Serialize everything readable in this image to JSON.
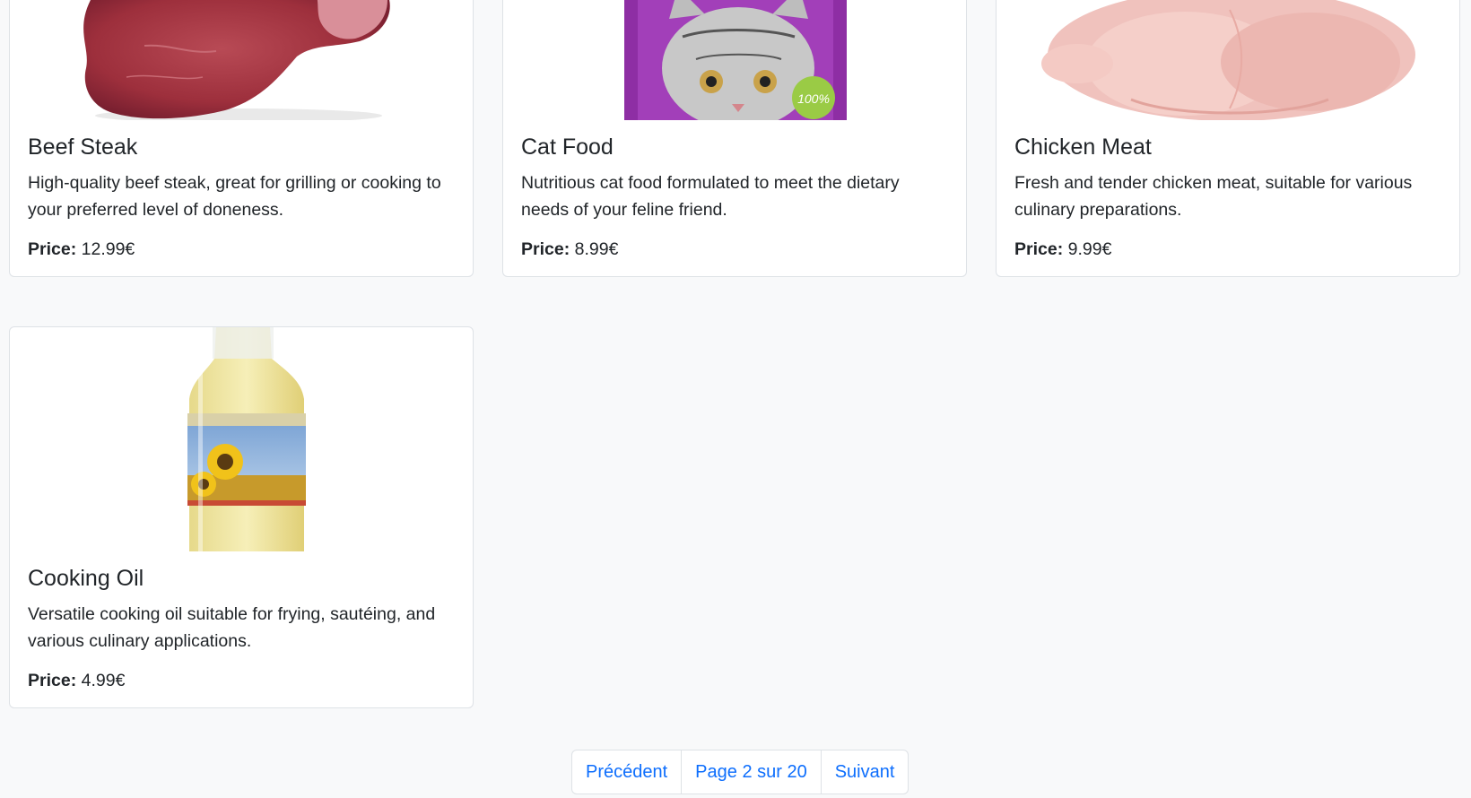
{
  "products": [
    {
      "title": "Beef Steak",
      "description": "High-quality beef steak, great for grilling or cooking to your preferred level of doneness.",
      "price_label": "Price:",
      "price": "12.99€",
      "image": "beef-steak-photo"
    },
    {
      "title": "Cat Food",
      "description": "Nutritious cat food formulated to meet the dietary needs of your feline friend.",
      "price_label": "Price:",
      "price": "8.99€",
      "image": "cat-food-pouch-photo"
    },
    {
      "title": "Chicken Meat",
      "description": "Fresh and tender chicken meat, suitable for various culinary preparations.",
      "price_label": "Price:",
      "price": "9.99€",
      "image": "raw-chicken-photo"
    },
    {
      "title": "Cooking Oil",
      "description": "Versatile cooking oil suitable for frying, sautéing, and various culinary applications.",
      "price_label": "Price:",
      "price": "4.99€",
      "image": "sunflower-oil-bottle-photo"
    }
  ],
  "pagination": {
    "previous": "Précédent",
    "current": "Page 2 sur 20",
    "next": "Suivant"
  },
  "colors": {
    "link": "#0d6efd",
    "background": "#f8f9fa",
    "card_border": "#dee2e6"
  }
}
